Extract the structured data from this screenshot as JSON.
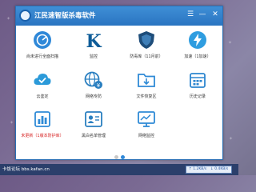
{
  "window": {
    "title": "江民速智版杀毒软件",
    "controls": {
      "menu": "☰",
      "minimize": "—",
      "close": "✕"
    }
  },
  "tiles": [
    {
      "label": "尚未进行全面扫描",
      "icon": "scan-icon",
      "color": "#2f88d8"
    },
    {
      "label": "监控",
      "icon": "k-monitor-icon",
      "color": "#0e5c98"
    },
    {
      "label": "防毒库（11月前）",
      "icon": "shield-icon",
      "color": "#1e4d7a"
    },
    {
      "label": "加速（1加速）",
      "icon": "cloud-speed-icon",
      "color": "#2f9de0"
    },
    {
      "label": "云鉴定",
      "icon": "cloud-check-icon",
      "color": "#2b9ad9"
    },
    {
      "label": "网络专防",
      "icon": "globe-yen-icon",
      "color": "#2a7fc0"
    },
    {
      "label": "文件恢复区",
      "icon": "folder-icon",
      "color": "#2f8ad6"
    },
    {
      "label": "历史记录",
      "icon": "calendar-icon",
      "color": "#2d86cf"
    },
    {
      "label": "未更新（1版本防护库）",
      "icon": "stats-icon",
      "color": "#2f8ad6",
      "alert": true
    },
    {
      "label": "黑白名单管理",
      "icon": "user-list-icon",
      "color": "#2a7fc0"
    },
    {
      "label": "网络监控",
      "icon": "monitor-icon",
      "color": "#2f8ad6"
    }
  ],
  "pager": {
    "pages": 2,
    "current": 2
  },
  "taskbar": {
    "watermark": "卡饭论坛 bbs.kafan.cn",
    "net_up": "1.2KB/s",
    "net_down": "0.4KB/s"
  }
}
